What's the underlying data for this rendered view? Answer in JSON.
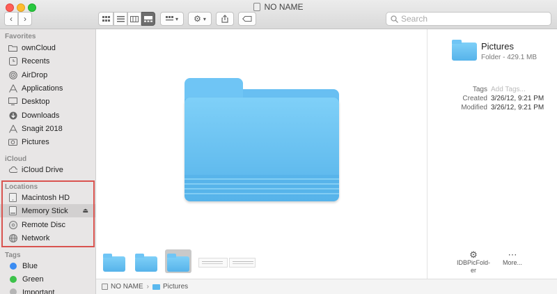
{
  "window": {
    "title": "NO NAME"
  },
  "toolbar": {
    "back": "‹",
    "forward": "›",
    "view_modes": [
      "icon-view",
      "list-view",
      "column-view",
      "gallery-view"
    ],
    "group_icon": "group-icon",
    "action_icon": "gear-icon",
    "share_icon": "share-icon",
    "tags_icon": "tag-icon",
    "search_placeholder": "Search"
  },
  "sidebar": {
    "favorites_header": "Favorites",
    "favorites": [
      {
        "label": "ownCloud",
        "icon": "folder-icon"
      },
      {
        "label": "Recents",
        "icon": "clock-icon"
      },
      {
        "label": "AirDrop",
        "icon": "airdrop-icon"
      },
      {
        "label": "Applications",
        "icon": "applications-icon"
      },
      {
        "label": "Desktop",
        "icon": "desktop-icon"
      },
      {
        "label": "Downloads",
        "icon": "download-icon"
      },
      {
        "label": "Snagit 2018",
        "icon": "applications-icon"
      },
      {
        "label": "Pictures",
        "icon": "camera-icon"
      }
    ],
    "icloud_header": "iCloud",
    "icloud": [
      {
        "label": "iCloud Drive",
        "icon": "cloud-icon"
      }
    ],
    "locations_header": "Locations",
    "locations": [
      {
        "label": "Macintosh HD",
        "icon": "hard-drive-icon"
      },
      {
        "label": "Memory Stick",
        "icon": "drive-icon",
        "selected": true,
        "eject": "⏏"
      },
      {
        "label": "Remote Disc",
        "icon": "disc-icon"
      },
      {
        "label": "Network",
        "icon": "globe-icon"
      }
    ],
    "tags_header": "Tags",
    "tags": [
      {
        "label": "Blue",
        "color": "#3b8cf2"
      },
      {
        "label": "Green",
        "color": "#3cc24a"
      },
      {
        "label": "Important",
        "color": "#b5b5b5"
      }
    ]
  },
  "info": {
    "name": "Pictures",
    "kind": "Folder - 429.1 MB",
    "tags_label": "Tags",
    "tags_placeholder": "Add Tags...",
    "created_label": "Created",
    "created_value": "3/26/12, 9:21 PM",
    "modified_label": "Modified",
    "modified_value": "3/26/12, 9:21 PM",
    "actions": [
      {
        "label": "IDBPicFold-\ner",
        "icon": "gear-icon"
      },
      {
        "label": "More...",
        "icon": "more-icon"
      }
    ]
  },
  "pathbar": {
    "root": "NO NAME",
    "separator": "›",
    "current": "Pictures"
  },
  "colors": {
    "highlight": "#d9534f",
    "folder": "#68bff2",
    "selection": "#d2d0d0"
  }
}
